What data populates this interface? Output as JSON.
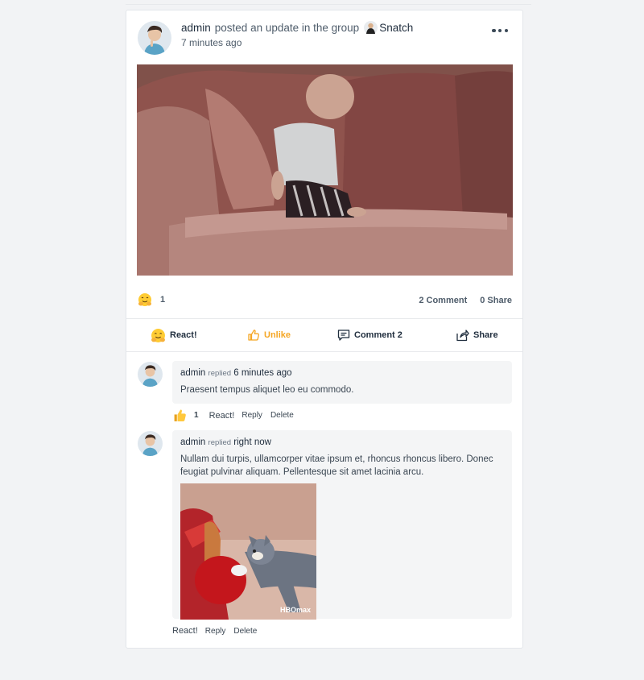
{
  "post": {
    "author": "admin",
    "action_text": "posted an update in the group",
    "group_name": "Snatch",
    "time": "7 minutes ago",
    "reaction_count": "1",
    "comment_count_label": "2 Comment",
    "share_count_label": "0 Share"
  },
  "actions": {
    "react": "React!",
    "unlike": "Unlike",
    "comment": "Comment 2",
    "share": "Share"
  },
  "comments": [
    {
      "author": "admin",
      "replied": "replied",
      "time": "6 minutes ago",
      "text": "Praesent tempus aliquet leo eu commodo.",
      "reaction_count": "1",
      "react_label": "React!",
      "reply_label": "Reply",
      "delete_label": "Delete"
    },
    {
      "author": "admin",
      "replied": "replied",
      "time": "right now",
      "text": "Nullam dui turpis, ullamcorper vitae ipsum et, rhoncus rhoncus libero. Donec feugiat pulvinar aliquam. Pellentesque sit amet lacinia arcu.",
      "media_watermark": "HBOmax",
      "react_label": "React!",
      "reply_label": "Reply",
      "delete_label": "Delete"
    }
  ],
  "colors": {
    "accent_unlike": "#f5a623",
    "text_primary": "#1f2d3d",
    "bubble_bg": "#f4f5f6"
  },
  "icons": [
    "more-icon",
    "hug-emoji-icon",
    "thumbs-up-icon",
    "comment-icon",
    "share-icon",
    "group-icon"
  ]
}
